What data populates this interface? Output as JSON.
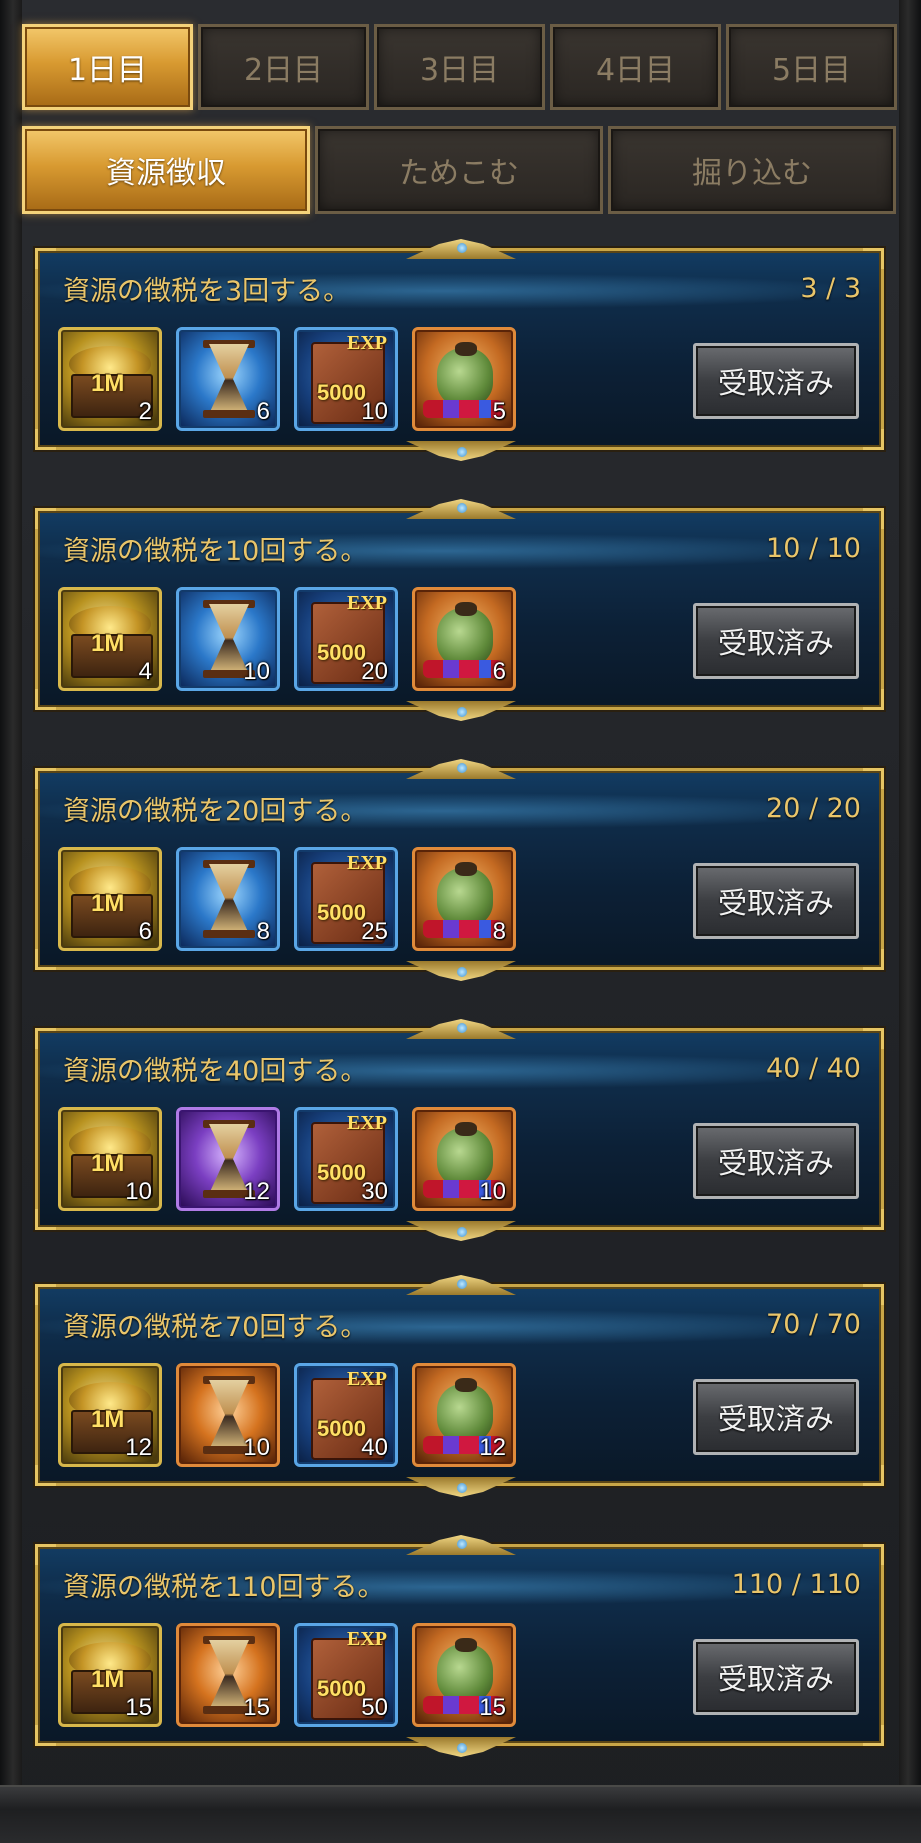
{
  "tabs_days": [
    "1日目",
    "2日目",
    "3日目",
    "4日目",
    "5日目"
  ],
  "tabs_sub": [
    "資源徴収",
    "ためこむ",
    "掘り込む"
  ],
  "active_day_index": 0,
  "active_sub_index": 0,
  "claim_label": "受取済み",
  "colors": {
    "accent_gold": "#e9c56a",
    "card_border": "#c9a647",
    "active_tab": "#d89a31"
  },
  "quests": [
    {
      "title": "資源の徴税を3回する。",
      "progress": "3 / 3",
      "items": [
        {
          "icon": "gold-chest-icon",
          "label": "1M",
          "count": "2"
        },
        {
          "icon": "hourglass-blue-icon",
          "count": "6"
        },
        {
          "icon": "exp-book-icon",
          "exp": "EXP",
          "label": "5000",
          "count": "10"
        },
        {
          "icon": "gem-bag-icon",
          "count": "5"
        }
      ]
    },
    {
      "title": "資源の徴税を10回する。",
      "progress": "10 / 10",
      "items": [
        {
          "icon": "gold-chest-icon",
          "label": "1M",
          "count": "4"
        },
        {
          "icon": "hourglass-blue-icon",
          "count": "10"
        },
        {
          "icon": "exp-book-icon",
          "exp": "EXP",
          "label": "5000",
          "count": "20"
        },
        {
          "icon": "gem-bag-icon",
          "count": "6"
        }
      ]
    },
    {
      "title": "資源の徴税を20回する。",
      "progress": "20 / 20",
      "items": [
        {
          "icon": "gold-chest-icon",
          "label": "1M",
          "count": "6"
        },
        {
          "icon": "hourglass-blue-icon",
          "count": "8"
        },
        {
          "icon": "exp-book-icon",
          "exp": "EXP",
          "label": "5000",
          "count": "25"
        },
        {
          "icon": "gem-bag-icon",
          "count": "8"
        }
      ]
    },
    {
      "title": "資源の徴税を40回する。",
      "progress": "40 / 40",
      "items": [
        {
          "icon": "gold-chest-icon",
          "label": "1M",
          "count": "10"
        },
        {
          "icon": "hourglass-purple-icon",
          "count": "12"
        },
        {
          "icon": "exp-book-icon",
          "exp": "EXP",
          "label": "5000",
          "count": "30"
        },
        {
          "icon": "gem-bag-icon",
          "count": "10"
        }
      ]
    },
    {
      "title": "資源の徴税を70回する。",
      "progress": "70 / 70",
      "items": [
        {
          "icon": "gold-chest-icon",
          "label": "1M",
          "count": "12"
        },
        {
          "icon": "hourglass-orange-icon",
          "count": "10"
        },
        {
          "icon": "exp-book-icon",
          "exp": "EXP",
          "label": "5000",
          "count": "40"
        },
        {
          "icon": "gem-bag-icon",
          "count": "12"
        }
      ]
    },
    {
      "title": "資源の徴税を110回する。",
      "progress": "110 / 110",
      "items": [
        {
          "icon": "gold-chest-icon",
          "label": "1M",
          "count": "15"
        },
        {
          "icon": "hourglass-orange-icon",
          "count": "15"
        },
        {
          "icon": "exp-book-icon",
          "exp": "EXP",
          "label": "5000",
          "count": "50"
        },
        {
          "icon": "gem-bag-icon",
          "count": "15"
        }
      ]
    }
  ]
}
